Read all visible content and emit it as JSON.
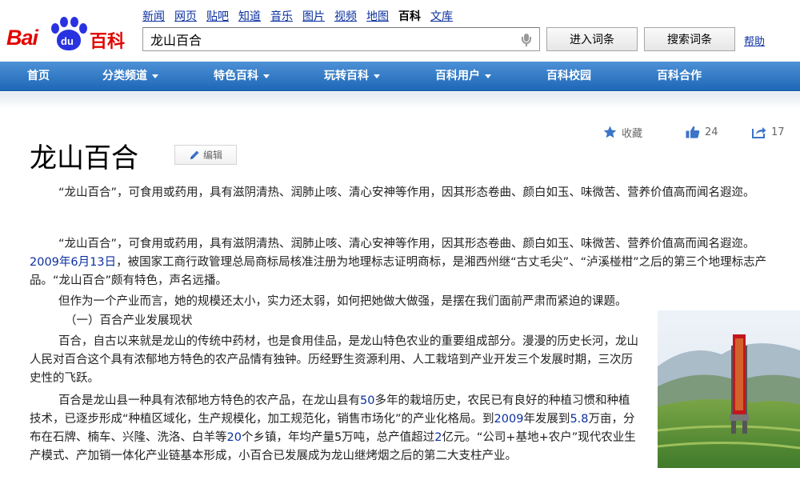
{
  "header": {
    "logo_text_bai": "Bai",
    "logo_text_du": "du",
    "logo_text_baike": "百科",
    "top_nav": [
      "新闻",
      "网页",
      "贴吧",
      "知道",
      "音乐",
      "图片",
      "视频",
      "地图",
      "百科",
      "文库"
    ],
    "top_nav_current": "百科",
    "search_value": "龙山百合",
    "enter_button": "进入词条",
    "search_button": "搜索词条",
    "help_link": "帮助"
  },
  "main_nav": [
    {
      "label": "首页",
      "has_dropdown": false
    },
    {
      "label": "分类频道",
      "has_dropdown": true
    },
    {
      "label": "特色百科",
      "has_dropdown": true
    },
    {
      "label": "玩转百科",
      "has_dropdown": true
    },
    {
      "label": "百科用户",
      "has_dropdown": true
    },
    {
      "label": "百科校园",
      "has_dropdown": false
    },
    {
      "label": "百科合作",
      "has_dropdown": false
    }
  ],
  "article": {
    "title": "龙山百合",
    "edit_label": "编辑",
    "actions": {
      "favorite_label": "收藏",
      "like_count": "24",
      "share_count": "17"
    },
    "summary": "“龙山百合”，可食用或药用，具有滋阴清热、润肺止咳、清心安神等作用，因其形态卷曲、颜白如玉、味微苦、营养价值高而闻名遐迩。",
    "para2_a": "“龙山百合”，可食用或药用，具有滋阴清热、润肺止咳、清心安神等作用，因其形态卷曲、颜白如玉、味微苦、营养价值高而闻名遐迩。",
    "para2_date": "2009年6月13日",
    "para2_b": "，被国家工商行政管理总局商标局核准注册为地理标志证明商标，是湘西州继“古丈毛尖”、“泸溪椪柑”之后的第三个地理标志产品。“龙山百合”颇有特色，声名远播。",
    "para3": "但作为一个产业而言，她的规模还太小，实力还太弱，如何把她做大做强，是摆在我们面前严肃而紧迫的课题。",
    "section_heading": "（一）百合产业发展现状",
    "para5": "百合，自古以来就是龙山的传统中药材，也是食用佳品，是龙山特色农业的重要组成部分。漫漫的历史长河，龙山人民对百合这个具有浓郁地方特色的农产品情有独钟。历经野生资源利用、人工栽培到产业开发三个发展时期，三次历史性的飞跃。",
    "para6_a": "百合是龙山县一种具有浓郁地方特色的农产品，在龙山县有",
    "para6_num1": "50",
    "para6_b": "多年的栽培历史，农民已有良好的种植习惯和种植技术，已逐步形成“种植区域化，生产规模化，加工规范化，销售市场化”的产业化格局。到",
    "para6_num2": "2009",
    "para6_c": "年发展到",
    "para6_num3": "5.8",
    "para6_d": "万亩，分布在石牌、楠车、兴隆、洗洛、白羊等",
    "para6_num4": "20",
    "para6_e": "个乡镇，年均产量5万吨，总产值超过",
    "para6_num5": "2",
    "para6_f": "亿元。“公司+基地+农户”现代农业生产模式、产加销一体化产业链基本形成，小百合已发展成为龙山继烤烟之后的第二大支柱产业。"
  },
  "colors": {
    "nav_bar": "#2a72c2",
    "link": "#0b30a0",
    "logo_red": "#e10602",
    "logo_blue": "#2932e1"
  }
}
